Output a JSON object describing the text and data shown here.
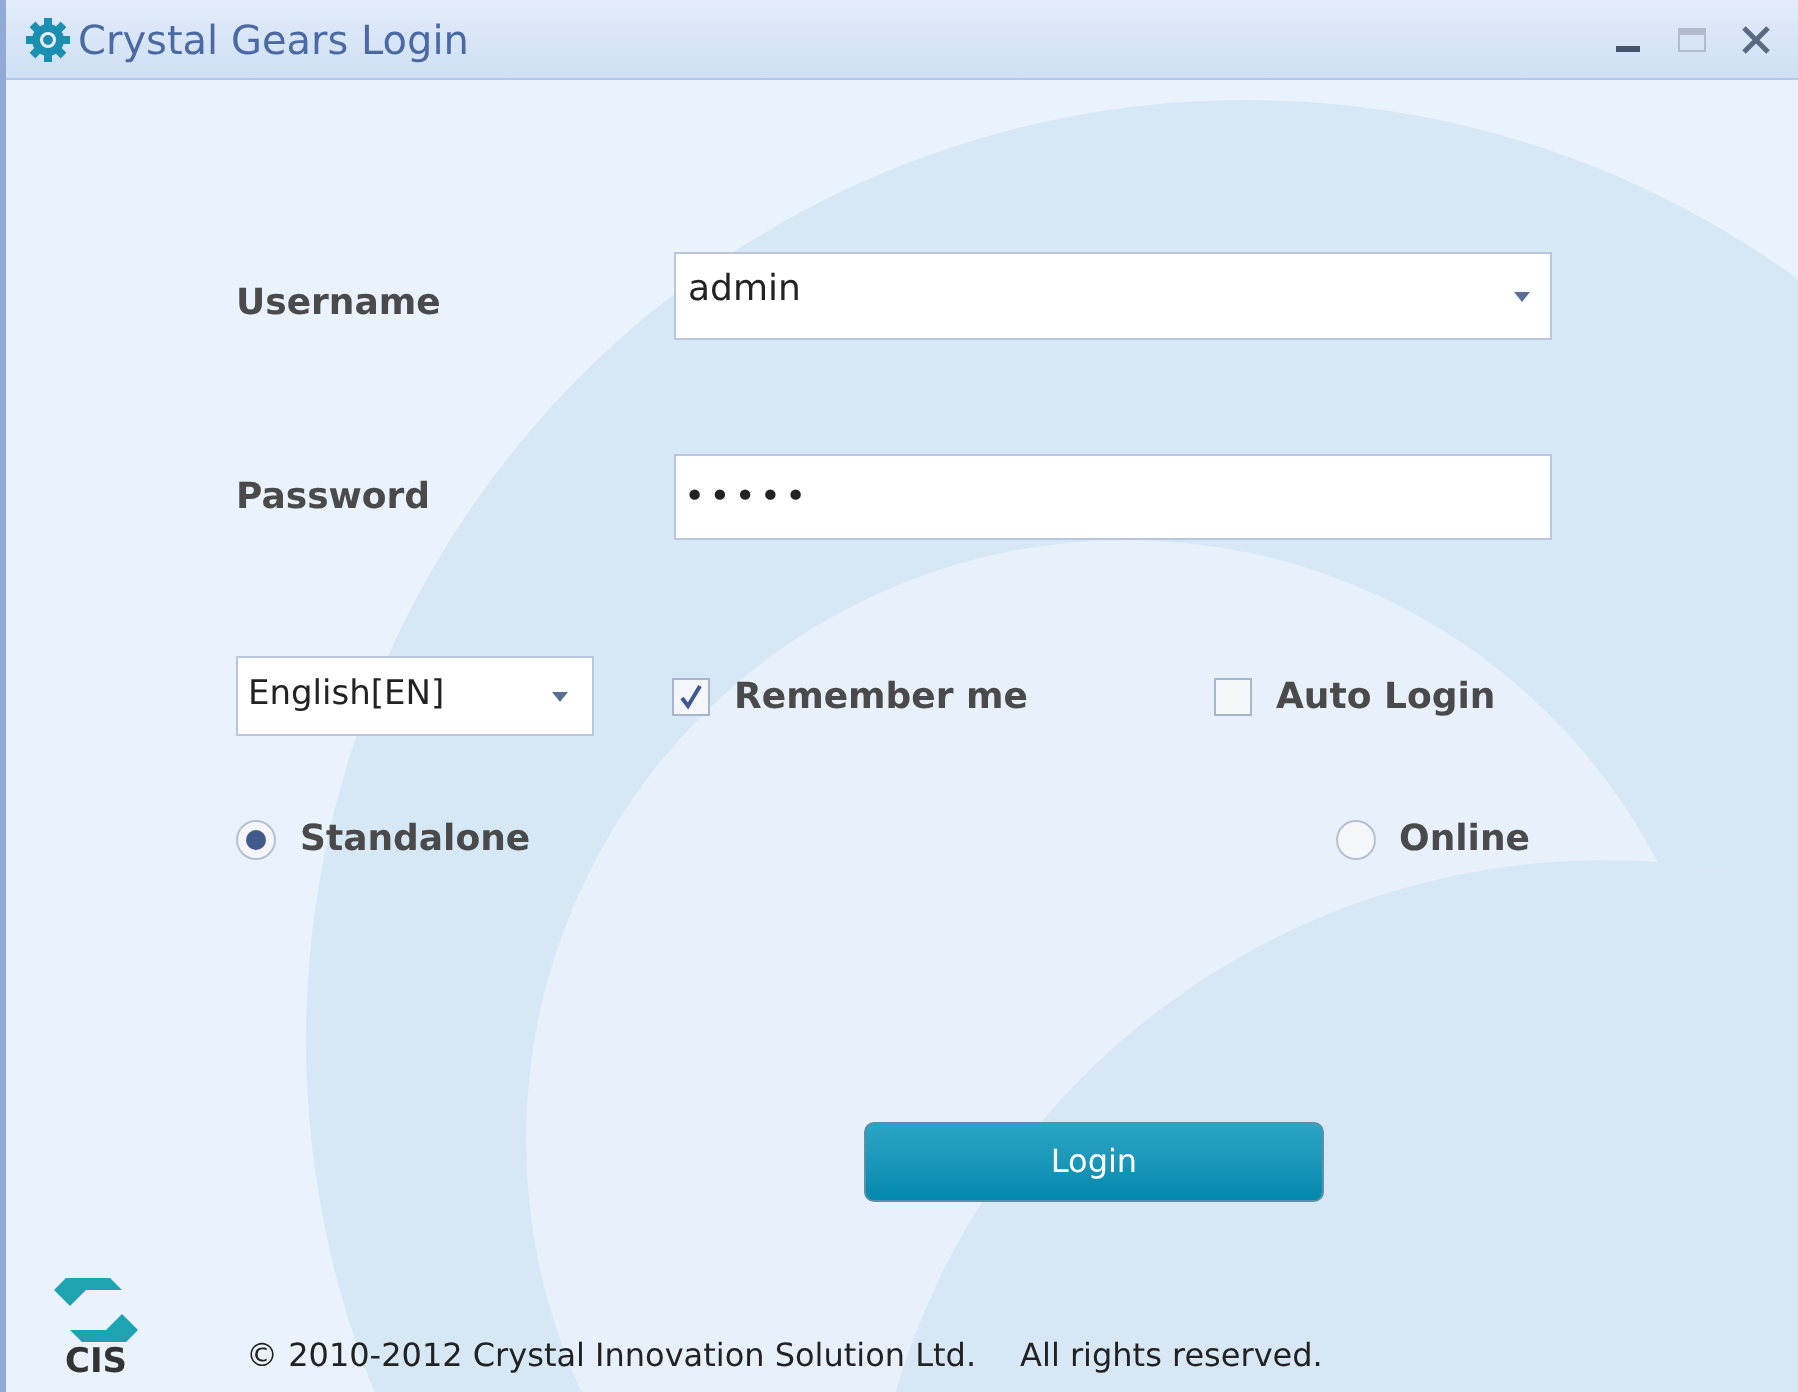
{
  "window": {
    "title": "Crystal Gears Login"
  },
  "username": {
    "label": "Username",
    "value": "admin"
  },
  "password": {
    "label": "Password",
    "value": "•••••"
  },
  "language": {
    "value": "English[EN]"
  },
  "options": [
    {
      "label": "Remember me",
      "checked": true
    },
    {
      "label": "Auto Login",
      "checked": false
    }
  ],
  "modes": [
    {
      "label": "Standalone",
      "selected": true
    },
    {
      "label": "Online",
      "selected": false
    }
  ],
  "login_button": "Login",
  "logo": {
    "text": "CIS"
  },
  "footer": {
    "copyright": "© 2010-2012 Crystal Innovation Solution Ltd.",
    "rights": "All rights reserved."
  }
}
